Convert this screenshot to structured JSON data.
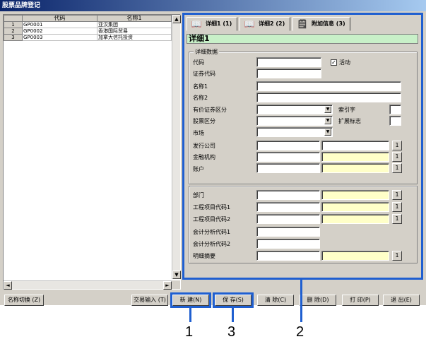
{
  "window": {
    "title": "股票品牌登记"
  },
  "grid": {
    "columns": [
      "代码",
      "名称1"
    ],
    "rows": [
      {
        "num": "1",
        "code": "GP0001",
        "name": "亚汉集团"
      },
      {
        "num": "2",
        "code": "GP0002",
        "name": "香港国际贸易"
      },
      {
        "num": "3",
        "code": "GP0003",
        "name": "加拿大信托投资"
      }
    ]
  },
  "tabs": [
    {
      "label": "详细1 (1)",
      "icon": "book-icon"
    },
    {
      "label": "详细2 (2)",
      "icon": "book-icon"
    },
    {
      "label": "附加信息 (3)",
      "icon": "note-icon"
    }
  ],
  "detail": {
    "heading": "详细1",
    "group1_title": "详细数据",
    "labels": {
      "code": "代码",
      "active": "活动",
      "security_code": "证券代码",
      "name1": "名称1",
      "name2": "名称2",
      "security_category": "有价证券区分",
      "index_char": "索引字",
      "stock_category": "股票区分",
      "extension_flag": "扩展标志",
      "market": "市场",
      "issuer": "发行公司",
      "financial_institution": "金融机构",
      "account": "账户",
      "department": "部门",
      "project_code1": "工程项目代码1",
      "project_code2": "工程项目代码2",
      "analysis_code1": "会计分析代码1",
      "analysis_code2": "会计分析代码2",
      "summary": "明细摘要"
    },
    "active_checked": true,
    "dropdown_glyph": "▼",
    "picker_glyph": "1"
  },
  "buttons": {
    "name_switch": "名称切换 (Z)",
    "trade_input": "交易输入 (T)",
    "new": "新  建(N)",
    "save": "保  存(S)",
    "clear": "清  除(C)",
    "delete": "删  除(D)",
    "print": "打  印(P)",
    "exit": "退  出(E)"
  },
  "callouts": {
    "c1": "1",
    "c2": "2",
    "c3": "3"
  },
  "colors": {
    "highlight": "#1f5fd0",
    "heading_bg": "#c8f0c8",
    "ref_field_bg": "#ffffc8"
  }
}
